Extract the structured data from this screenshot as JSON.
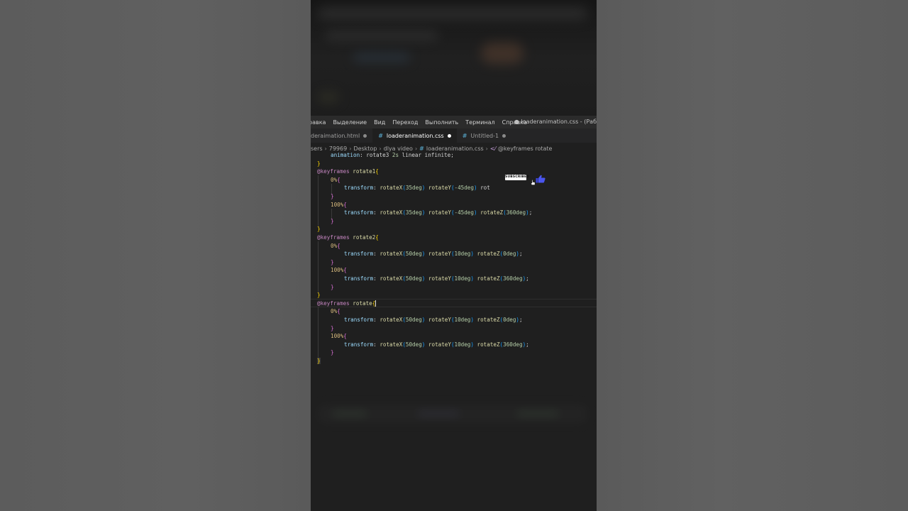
{
  "menu": {
    "items": [
      "равка",
      "Выделение",
      "Вид",
      "Переход",
      "Выполнить",
      "Терминал",
      "Справка"
    ],
    "window_title": "● loaderanimation.css - (Раб"
  },
  "tabs": [
    {
      "label": "deraimation.html",
      "icon": "css-hash-icon",
      "active": false,
      "modified": true
    },
    {
      "label": "loaderanimation.css",
      "icon": "css-hash-icon",
      "active": true,
      "modified": true
    },
    {
      "label": "Untitled-1",
      "icon": "css-hash-icon",
      "active": false,
      "modified": true
    }
  ],
  "breadcrumb": {
    "parts": [
      "sers",
      "79969",
      "Desktop",
      "dlya video"
    ],
    "file": "loaderanimation.css",
    "symbol": "@keyframes rotate"
  },
  "overlay": {
    "subscribe_label": "SUBSCRIBED"
  },
  "code": {
    "line0": [
      "animation",
      ":",
      " rotate3 ",
      "2s",
      " linear infinite;"
    ],
    "kf1": [
      "@keyframes",
      " rotate1",
      "{"
    ],
    "p0": "0%",
    "p100": "100%",
    "t": "transform",
    "rx35": "rotateX",
    "v35": "35deg",
    "ry": "rotateY",
    "vm45": "-45deg",
    "rot": " rot",
    "rz": "rotateZ",
    "v360": "360deg",
    "kf2": [
      "@keyframes",
      " rotate2",
      "{"
    ],
    "v50": "50deg",
    "v10": "10deg",
    "v0": "0deg",
    "kf3": [
      "@keyframes",
      " rotate"
    ]
  },
  "colors": {
    "editor_bg": "#1f1f1f",
    "menu_bg": "#2b2b2b",
    "tab_bg": "#252526",
    "accent_hash": "#519aba",
    "keyword": "#c586c0",
    "number": "#b5cea8"
  }
}
